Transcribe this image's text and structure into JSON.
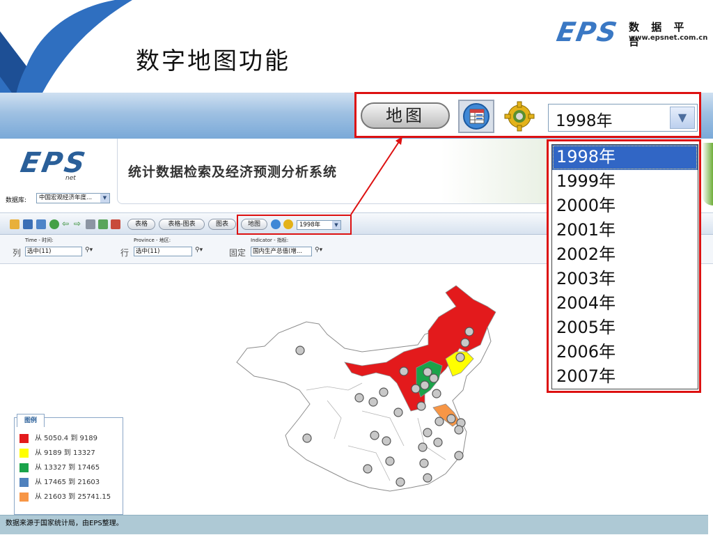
{
  "slide": {
    "title": "数字地图功能",
    "brand": {
      "logo": "EPS",
      "sub": "net",
      "name_cn": "数 据 平 台",
      "url": "www.epsnet.com.cn"
    }
  },
  "zoom_controls": {
    "map_button": "地图",
    "year_value": "1998年"
  },
  "app": {
    "logo": "EPS",
    "logo_sub": "net",
    "title": "统计数据检索及经济预测分析系统",
    "database": {
      "label": "数据库:",
      "value": "中国宏观经济年度..."
    },
    "toolbar": {
      "buttons": [
        "表格",
        "表格-图表",
        "图表",
        "地图"
      ],
      "year_value": "1998年"
    },
    "filters": {
      "time": {
        "label": "Time - 时间:",
        "prefix": "列",
        "value": "选中(11)"
      },
      "province": {
        "label": "Province - 地区:",
        "prefix": "行",
        "value": "选中(11)"
      },
      "indicator": {
        "label": "Indicator - 指标:",
        "prefix": "固定",
        "value": "国内生产总值(增..."
      }
    },
    "legend": {
      "title": "图例",
      "items": [
        {
          "label": "从 5050.4 到 9189",
          "color": "#e31a1c"
        },
        {
          "label": "从 9189 到 13327",
          "color": "#ffff00"
        },
        {
          "label": "从 13327 到 17465",
          "color": "#1aa34a"
        },
        {
          "label": "从 17465 到 21603",
          "color": "#4f81bd"
        },
        {
          "label": "从 21603 到 25741.15",
          "color": "#f79646"
        }
      ]
    },
    "status": "数据来源于国家统计局，由EPS整理。"
  },
  "year_dropdown": {
    "options": [
      "1998年",
      "1999年",
      "2000年",
      "2001年",
      "2002年",
      "2003年",
      "2004年",
      "2005年",
      "2006年",
      "2007年"
    ],
    "selected": "1998年"
  }
}
